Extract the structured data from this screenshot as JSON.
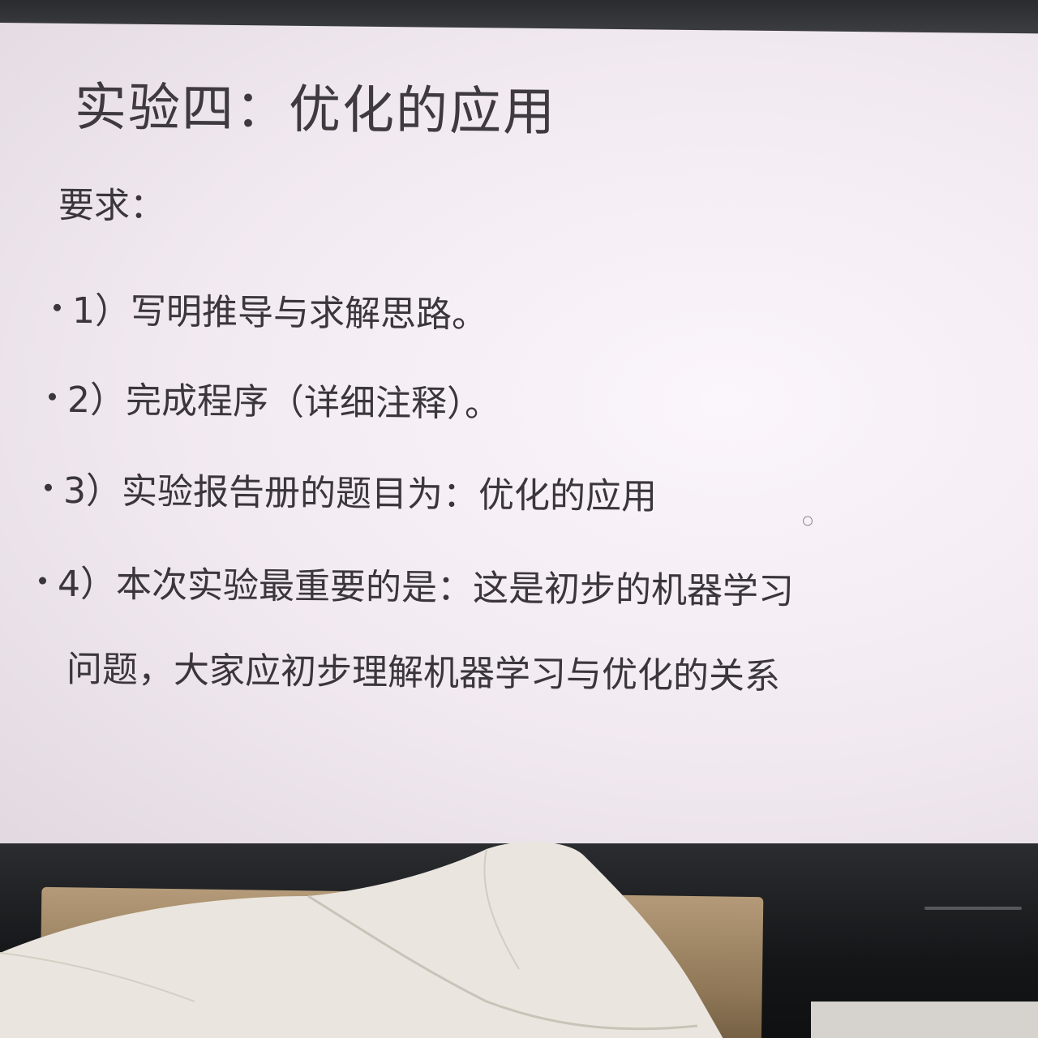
{
  "slide": {
    "title": "实验四：优化的应用",
    "requirements_label": "要求：",
    "items": [
      "1）写明推导与求解思路。",
      "2）完成程序（详细注释）。",
      "3）实验报告册的题目为：优化的应用",
      "4）本次实验最重要的是：这是初步的机器学习"
    ],
    "item4_continuation": "问题，大家应初步理解机器学习与优化的关系"
  },
  "colors": {
    "screen_background": "#f5eef4",
    "text": "#3a363a",
    "bezel": "#1b1c1e"
  },
  "icons": {
    "zoom": "zoom-icon"
  }
}
